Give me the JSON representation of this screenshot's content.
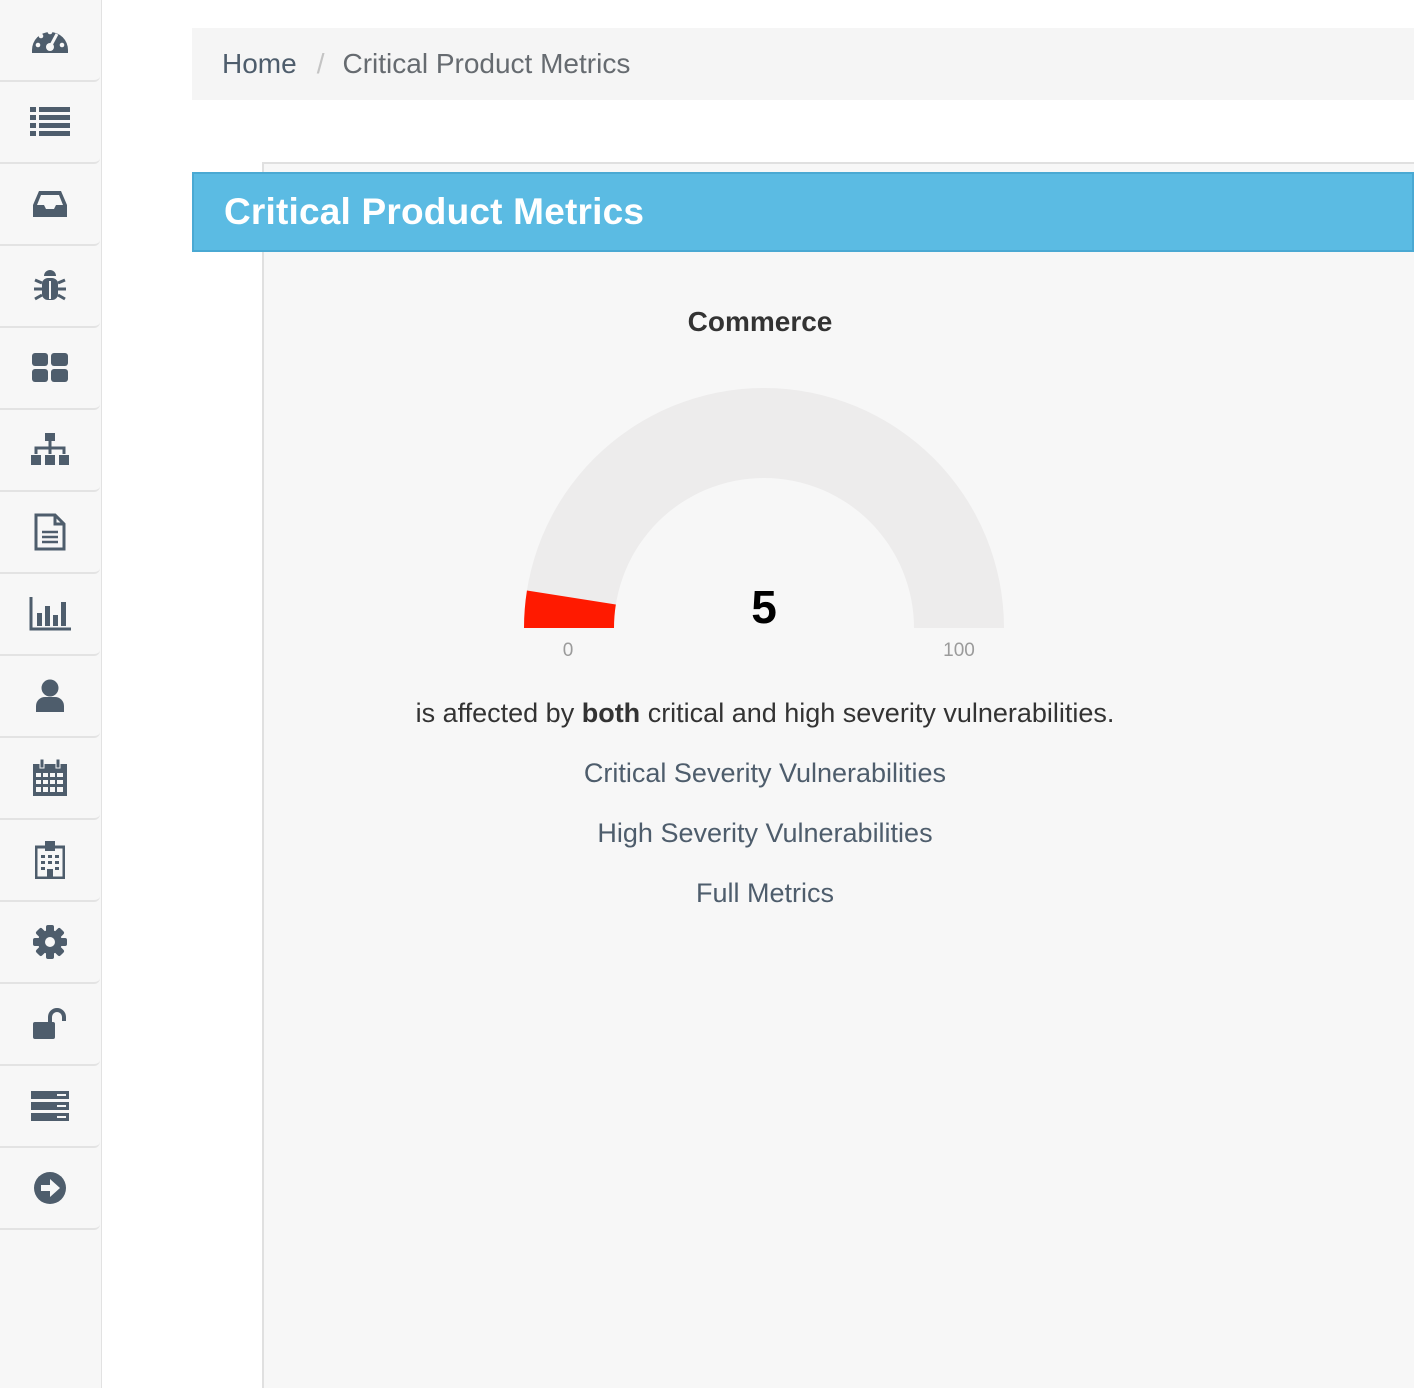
{
  "sidebar": {
    "items": [
      {
        "icon": "dashboard-icon"
      },
      {
        "icon": "list-icon"
      },
      {
        "icon": "inbox-icon"
      },
      {
        "icon": "bug-icon"
      },
      {
        "icon": "grid-icon"
      },
      {
        "icon": "sitemap-icon"
      },
      {
        "icon": "document-icon"
      },
      {
        "icon": "bar-chart-icon"
      },
      {
        "icon": "user-icon"
      },
      {
        "icon": "calendar-icon"
      },
      {
        "icon": "building-icon"
      },
      {
        "icon": "gear-icon"
      },
      {
        "icon": "unlock-icon"
      },
      {
        "icon": "server-icon"
      },
      {
        "icon": "arrow-right-circle-icon"
      }
    ],
    "icon_color": "#4e5d6c"
  },
  "breadcrumb": {
    "home": "Home",
    "separator": "/",
    "current": "Critical Product Metrics"
  },
  "panel": {
    "title": "Critical Product Metrics",
    "heading_color": "#5bbbe3"
  },
  "gauge": {
    "title": "Commerce",
    "value": 5,
    "value_label": "5",
    "min": 0,
    "max": 100,
    "min_label": "0",
    "max_label": "100",
    "fill_color": "#ff1a00",
    "track_color": "#edecec"
  },
  "summary": {
    "before": "is affected by ",
    "bold": "both",
    "after": " critical and high severity vulnerabilities."
  },
  "links": {
    "critical": "Critical Severity Vulnerabilities",
    "high": "High Severity Vulnerabilities",
    "full": "Full Metrics"
  }
}
